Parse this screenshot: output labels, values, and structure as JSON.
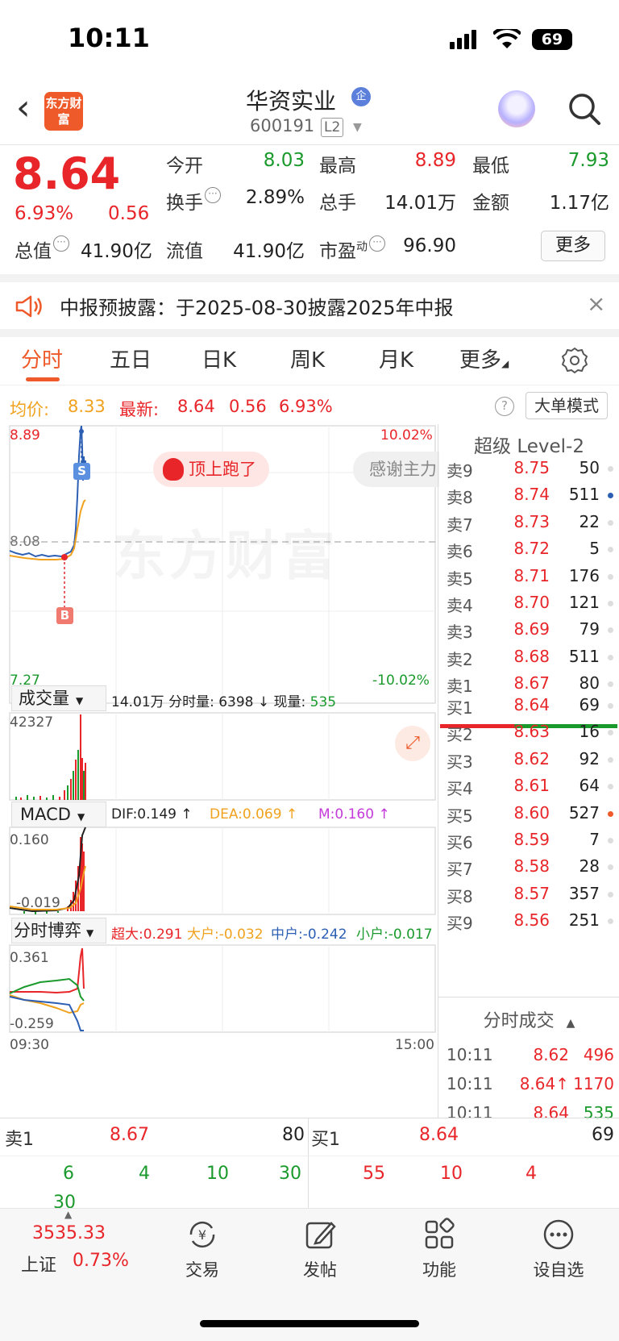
{
  "status_bar": {
    "time": "10:11",
    "battery": "69"
  },
  "header": {
    "logo_text": "东方财富",
    "stock_name": "华资实业",
    "badge": "企",
    "code": "600191",
    "level": "L2"
  },
  "quote": {
    "price": "8.64",
    "change_pct": "6.93%",
    "change": "0.56",
    "open_label": "今开",
    "open": "8.03",
    "high_label": "最高",
    "high": "8.89",
    "low_label": "最低",
    "low": "7.93",
    "turnover_label": "换手",
    "turnover": "2.89%",
    "volume_label": "总手",
    "volume": "14.01万",
    "amount_label": "金额",
    "amount": "1.17亿",
    "mktcap_label": "总值",
    "mktcap": "41.90亿",
    "float_label": "流值",
    "float_cap": "41.90亿",
    "pe_label": "市盈",
    "pe_sup": "动",
    "pe": "96.90",
    "more": "更多"
  },
  "notice": {
    "text": "中报预披露：于2025-08-30披露2025年中报"
  },
  "tabs": [
    "分时",
    "五日",
    "日K",
    "周K",
    "月K",
    "更多"
  ],
  "infobar": {
    "avg_label": "均价:",
    "avg": "8.33",
    "latest_label": "最新:",
    "latest": "8.64",
    "chg": "0.56",
    "pct": "6.93%",
    "mode": "大单模式"
  },
  "chart": {
    "y_top": "8.89",
    "y_mid": "8.08",
    "y_bot": "7.27",
    "pct_top": "10.02%",
    "pct_bot": "-10.02%",
    "watermark": "东方财富",
    "bubble1": "顶上跑了",
    "bubble2": "感谢主力",
    "marker_s": "S",
    "marker_b": "B",
    "vol_sel": "成交量",
    "vol_info1": "14.01万 分时量: 6398 ↓ 现量:",
    "vol_now": "535",
    "vol_max": "42327",
    "macd_sel": "MACD",
    "dif": "DIF:0.149 ↑",
    "dea": "DEA:0.069 ↑",
    "m": "M:0.160 ↑",
    "macd_top": "0.160",
    "macd_bot": "-0.019",
    "game_sel": "分时博弈",
    "super": "超大:0.291",
    "large": "大户:-0.032",
    "mid": "中户:-0.242",
    "small": "小户:-0.017",
    "game_top": "0.361",
    "game_bot": "-0.259",
    "t_start": "09:30",
    "t_end": "15:00"
  },
  "book": {
    "title": "超级 Level-2",
    "asks": [
      {
        "label": "卖9",
        "price": "8.75",
        "qty": "50"
      },
      {
        "label": "卖8",
        "price": "8.74",
        "qty": "511"
      },
      {
        "label": "卖7",
        "price": "8.73",
        "qty": "22"
      },
      {
        "label": "卖6",
        "price": "8.72",
        "qty": "5"
      },
      {
        "label": "卖5",
        "price": "8.71",
        "qty": "176"
      },
      {
        "label": "卖4",
        "price": "8.70",
        "qty": "121"
      },
      {
        "label": "卖3",
        "price": "8.69",
        "qty": "79"
      },
      {
        "label": "卖2",
        "price": "8.68",
        "qty": "511"
      },
      {
        "label": "卖1",
        "price": "8.67",
        "qty": "80"
      }
    ],
    "bids": [
      {
        "label": "买1",
        "price": "8.64",
        "qty": "69"
      },
      {
        "label": "买2",
        "price": "8.63",
        "qty": "16"
      },
      {
        "label": "买3",
        "price": "8.62",
        "qty": "92"
      },
      {
        "label": "买4",
        "price": "8.61",
        "qty": "64"
      },
      {
        "label": "买5",
        "price": "8.60",
        "qty": "527"
      },
      {
        "label": "买6",
        "price": "8.59",
        "qty": "7"
      },
      {
        "label": "买7",
        "price": "8.58",
        "qty": "28"
      },
      {
        "label": "买8",
        "price": "8.57",
        "qty": "357"
      },
      {
        "label": "买9",
        "price": "8.56",
        "qty": "251"
      }
    ],
    "tick_title": "分时成交",
    "ticks": [
      {
        "time": "10:11",
        "price": "8.62",
        "vol": "496"
      },
      {
        "time": "10:11",
        "price": "8.64↑",
        "vol": "1170"
      },
      {
        "time": "10:11",
        "price": "8.64",
        "vol": "535"
      }
    ]
  },
  "level1": {
    "ask_label": "卖1",
    "ask_price": "8.67",
    "ask_qty": "80",
    "bid_label": "买1",
    "bid_price": "8.64",
    "bid_qty": "69",
    "ask_orders": [
      "6",
      "4",
      "10",
      "30",
      "30"
    ],
    "bid_orders": [
      "55",
      "10",
      "4"
    ]
  },
  "bottom_nav": {
    "index_value": "3535.33",
    "index_name": "上证",
    "index_pct": "0.73%",
    "items": [
      "交易",
      "发帖",
      "功能",
      "设自选"
    ]
  }
}
